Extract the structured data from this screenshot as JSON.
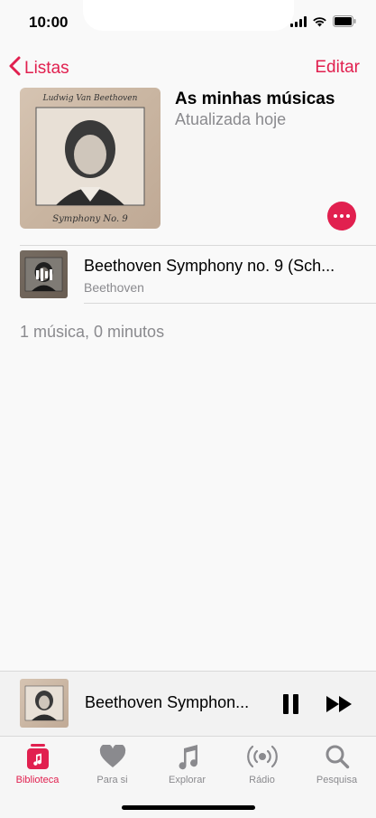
{
  "status_bar": {
    "time": "10:00"
  },
  "nav": {
    "back_label": "Listas",
    "edit_label": "Editar"
  },
  "playlist": {
    "title": "As minhas músicas",
    "subtitle": "Atualizada hoje",
    "art_top_text": "Ludwig Van Beethoven",
    "art_bottom_text": "Symphony No. 9"
  },
  "tracks": [
    {
      "title": "Beethoven Symphony no. 9 (Sch...",
      "artist": "Beethoven"
    }
  ],
  "summary": "1 música, 0 minutos",
  "mini_player": {
    "title": "Beethoven Symphon..."
  },
  "tabs": [
    {
      "label": "Biblioteca",
      "icon": "library-icon",
      "active": true
    },
    {
      "label": "Para si",
      "icon": "heart-icon",
      "active": false
    },
    {
      "label": "Explorar",
      "icon": "music-note-icon",
      "active": false
    },
    {
      "label": "Rádio",
      "icon": "radio-icon",
      "active": false
    },
    {
      "label": "Pesquisa",
      "icon": "search-icon",
      "active": false
    }
  ],
  "colors": {
    "accent": "#e1204f",
    "secondary_text": "#8a8a8e",
    "background": "#f9f9f9"
  }
}
